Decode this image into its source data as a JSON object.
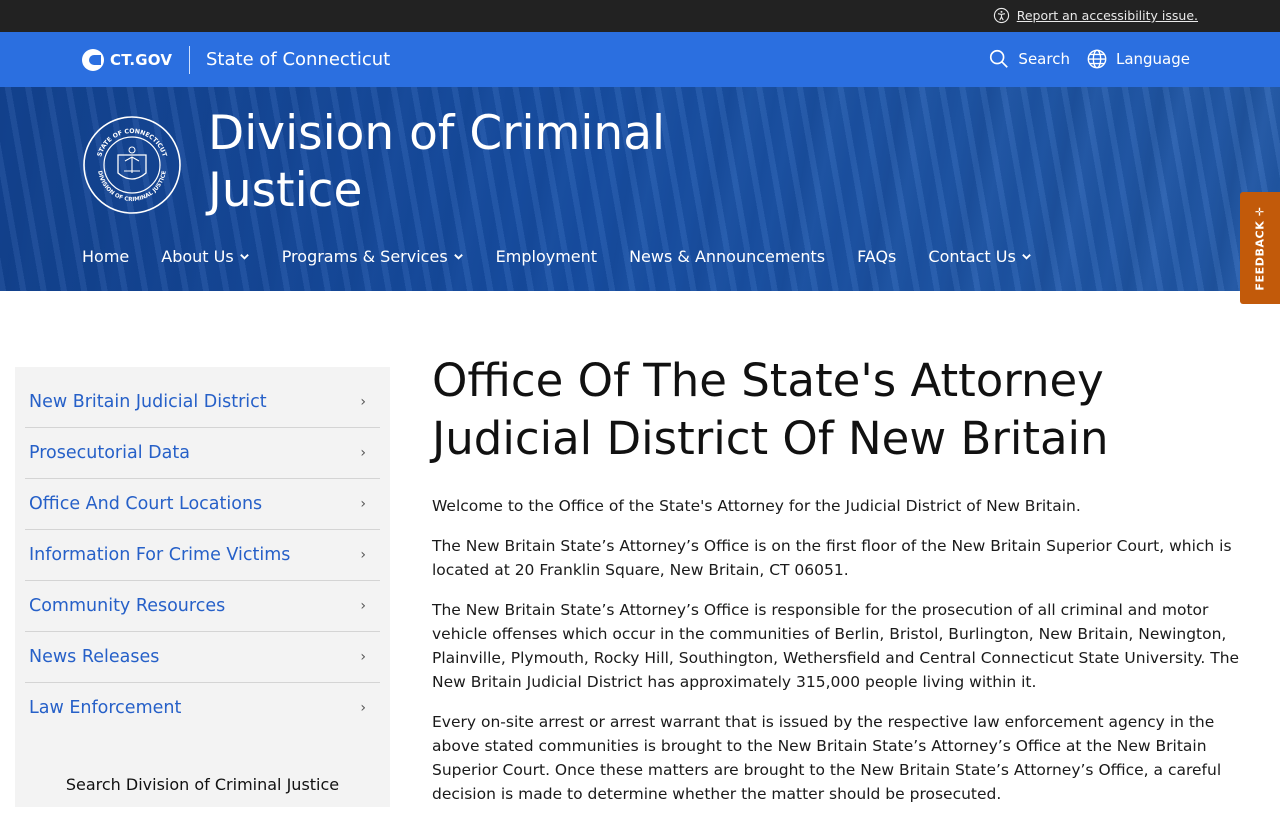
{
  "util_bar": {
    "accessibility_link": "Report an accessibility issue.",
    "accessibility_icon": "accessibility-icon"
  },
  "ct_header": {
    "logo_text": "CT.GOV",
    "state_name": "State of Connecticut",
    "search_label": "Search",
    "language_label": "Language"
  },
  "hero": {
    "seal_icon": "state-seal-icon",
    "seal_text_top": "STATE OF CONNECTICUT",
    "seal_text_bottom": "DIVISION OF CRIMINAL JUSTICE",
    "title": "Division of Criminal Justice"
  },
  "nav": {
    "items": [
      {
        "label": "Home",
        "has_menu": false
      },
      {
        "label": "About Us",
        "has_menu": true
      },
      {
        "label": "Programs & Services",
        "has_menu": true
      },
      {
        "label": "Employment",
        "has_menu": false
      },
      {
        "label": "News & Announcements",
        "has_menu": false
      },
      {
        "label": "FAQs",
        "has_menu": false
      },
      {
        "label": "Contact Us",
        "has_menu": true
      }
    ]
  },
  "feedback": {
    "label": "FEEDBACK"
  },
  "sidebar": {
    "items": [
      {
        "label": "New Britain Judicial District"
      },
      {
        "label": "Prosecutorial Data"
      },
      {
        "label": "Office And Court Locations"
      },
      {
        "label": "Information For Crime Victims"
      },
      {
        "label": "Community Resources"
      },
      {
        "label": "News Releases"
      },
      {
        "label": "Law Enforcement"
      }
    ],
    "search_label": "Search Division of Criminal Justice"
  },
  "main": {
    "title": "Office Of The State's Attorney Judicial District Of New Britain",
    "paragraphs": [
      "Welcome to the Office of the State's Attorney for the Judicial District of New Britain.",
      "The New Britain State’s Attorney’s Office is on the first floor of the New Britain Superior Court, which is located at 20 Franklin Square, New Britain, CT 06051.",
      "The New Britain State’s Attorney’s Office is responsible for the prosecution of all criminal and motor vehicle offenses which occur in the communities of Berlin, Bristol, Burlington, New Britain, Newington, Plainville, Plymouth, Rocky Hill, Southington, Wethersfield and Central Connecticut State University. The New Britain Judicial District has approximately 315,000 people living within it.",
      "Every on-site arrest or arrest warrant that is issued by the respective law enforcement agency in the above stated communities is brought to the New Britain State’s Attorney’s Office at the New Britain Superior Court.  Once these matters are brought to the New Britain State’s Attorney’s Office, a careful decision is made to determine whether the matter should be prosecuted."
    ]
  },
  "colors": {
    "util_bar": "#222222",
    "header_blue": "#2b6fe0",
    "hero_blue": "#1a4f9a",
    "link_blue": "#2660c8",
    "feedback_orange": "#c25a0a",
    "sidebar_bg": "#f3f3f3"
  }
}
